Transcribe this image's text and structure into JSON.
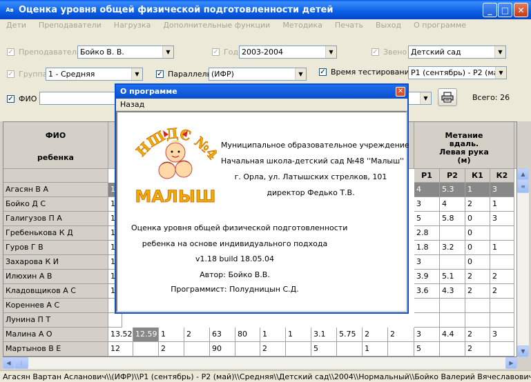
{
  "window": {
    "icon": "Ав",
    "title": "Оценка уровня общей физической подготовленности детей",
    "min": "_",
    "max": "□",
    "close": "✕"
  },
  "menu": [
    "Дети",
    "Преподаватели",
    "Нагрузка",
    "Дополнительные функции",
    "Методика",
    "Печать",
    "Выход",
    "О программе"
  ],
  "filters": {
    "teacher_label": "Преподаватель",
    "teacher_value": "Бойко В. В.",
    "year_label": "Год",
    "year_value": "2003-2004",
    "zveno_label": "Звено",
    "zveno_value": "Детский сад",
    "group_label": "Группа",
    "group_value": "1 - Средняя",
    "parallel_label": "Параллель",
    "parallel_value": "(ИФР)",
    "time_label": "Время тестирования",
    "time_value": "Р1 (сентябрь) - Р2 (май)",
    "fio_label": "ФИО",
    "total": "Всего: 26"
  },
  "grid": {
    "header_fio": "ФИО\n\nребенка",
    "header_throw": "Метание\nвдаль.\nЛевая рука\n(м)",
    "sub_headers": [
      "Р1",
      "Р2",
      "К1",
      "К2"
    ],
    "rows": [
      {
        "name": "Агасян  В А",
        "c1": "1",
        "r1": "4",
        "r2": "5.3",
        "k1": "1",
        "k2": "3",
        "selected": true
      },
      {
        "name": "Бойко  Д С",
        "c1": "1",
        "r1": "3",
        "r2": "4",
        "k1": "2",
        "k2": "1"
      },
      {
        "name": "Галигузов  П А",
        "c1": "1",
        "r1": "5",
        "r2": "5.8",
        "k1": "0",
        "k2": "3"
      },
      {
        "name": "Гребенькова  К Д",
        "c1": "1",
        "r1": "2.8",
        "r2": "",
        "k1": "0",
        "k2": ""
      },
      {
        "name": "Гуров  Г В",
        "c1": "1",
        "r1": "1.8",
        "r2": "3.2",
        "k1": "0",
        "k2": "1"
      },
      {
        "name": "Захарова  К И",
        "c1": "1",
        "r1": "3",
        "r2": "",
        "k1": "0",
        "k2": ""
      },
      {
        "name": "Илюхин  А В",
        "c1": "1",
        "r1": "3.9",
        "r2": "5.1",
        "k1": "2",
        "k2": "2"
      },
      {
        "name": "Кладовщиков  А С",
        "c1": "1",
        "r1": "3.6",
        "r2": "4.3",
        "k1": "2",
        "k2": "2"
      },
      {
        "name": "Кореннев  А С",
        "c1": "",
        "r1": "",
        "r2": "",
        "k1": "",
        "k2": ""
      },
      {
        "name": "Лунина  П Т",
        "c1": "",
        "r1": "",
        "r2": "",
        "k1": "",
        "k2": ""
      }
    ],
    "malina": {
      "name": "Малина  А О",
      "cells": [
        "13.52",
        "12.59",
        "1",
        "2",
        "63",
        "80",
        "1",
        "1",
        "3.1",
        "5.75",
        "2",
        "2",
        "3",
        "4.4",
        "2",
        "3"
      ]
    },
    "martynov": {
      "name": "Мартынов  В Е",
      "cells": [
        "12",
        "",
        "2",
        "",
        "90",
        "",
        "2",
        "",
        "5",
        "",
        "1",
        "",
        "5",
        "",
        "2",
        ""
      ]
    }
  },
  "status": "Агасян Вартан Асланович\\\\(ИФР)\\\\Р1 (сентябрь) - Р2 (май)\\\\Средняя\\\\Детский сад\\\\2004\\\\Нормальный\\\\Бойко Валерий Вячеславович",
  "dialog": {
    "title": "О программе",
    "menu_back": "Назад",
    "logo_top": "НШДС №48",
    "logo_bottom": "МАЛЫШ",
    "org1": "Муниципальное образовательное учреждение",
    "org2": "Начальная школа-детский сад №48 ''Малыш''",
    "org3": "г. Орла, ул. Латышских стрелков, 101",
    "org4": "директор Федько Т.В.",
    "prog1": "Оценка уровня общей физической подготовленности",
    "prog2": "ребенка на основе индивидуального подхода",
    "version": "v1.18 build 18.05.04",
    "author": "Автор: Бойко В.В.",
    "programmer": "Программист: Полудницын С.Д."
  }
}
